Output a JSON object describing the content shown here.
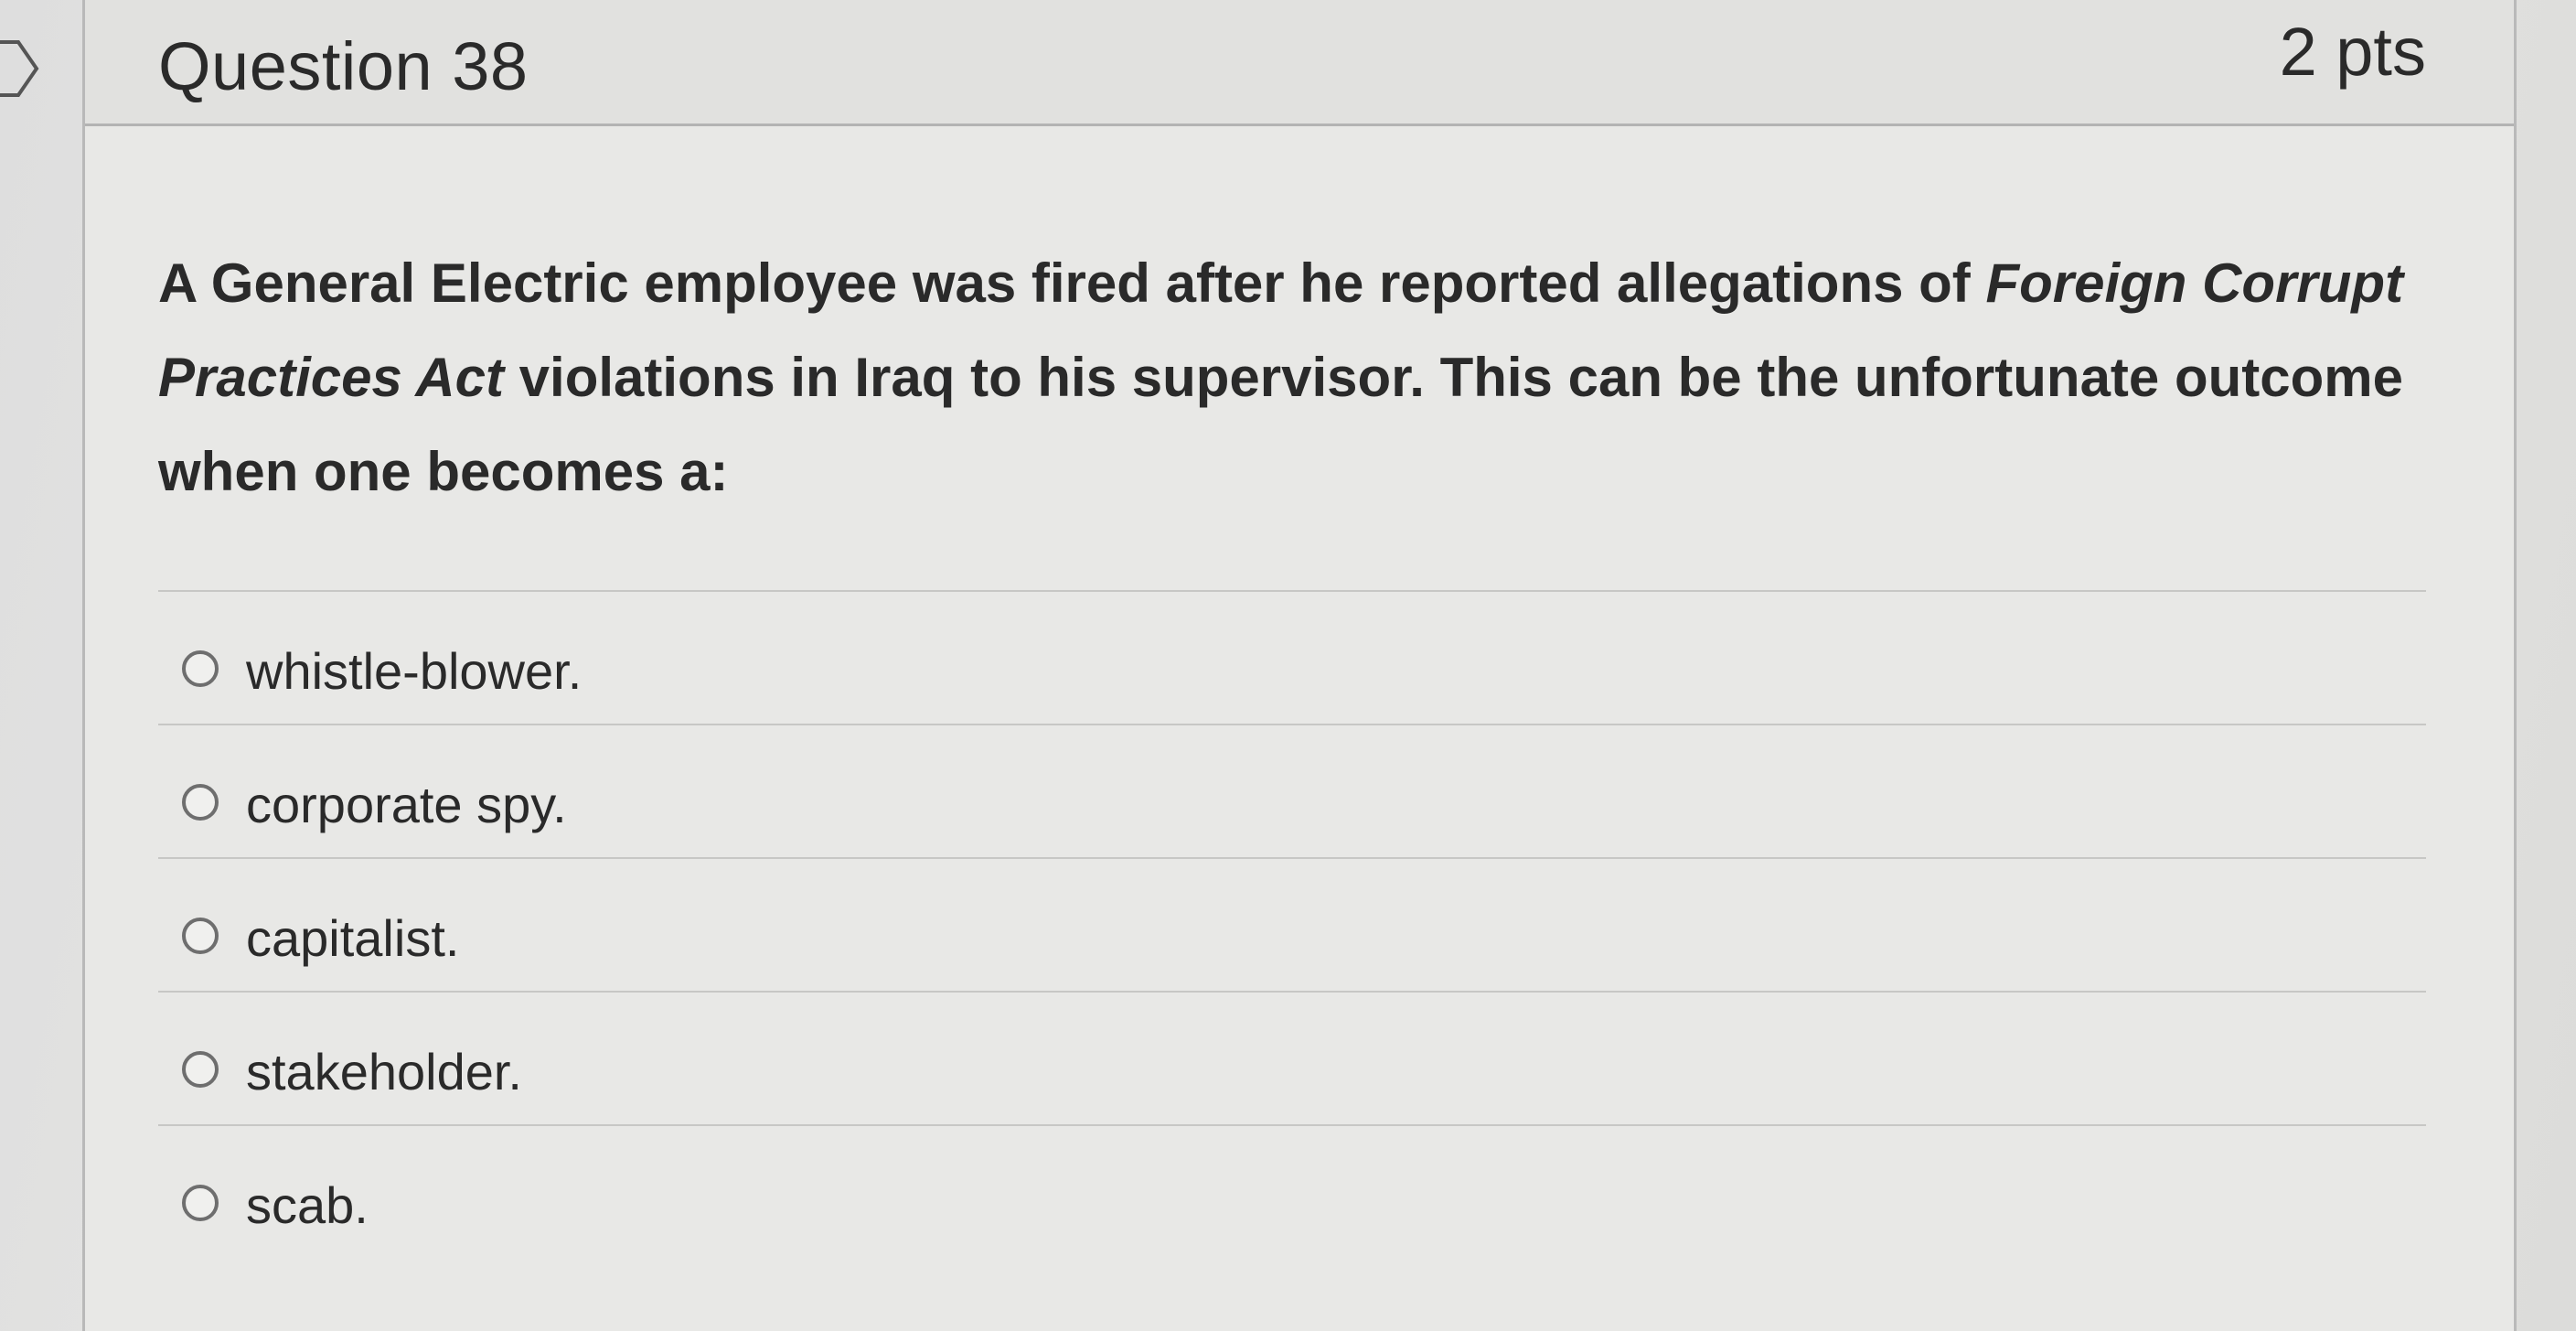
{
  "question": {
    "title": "Question 38",
    "points": "2 pts",
    "text_part1": "A General Electric employee was fired after he reported allegations of ",
    "text_italic": "Foreign Corrupt Practices Act",
    "text_part2": " violations in Iraq to his supervisor. This can be the unfortunate outcome when one becomes a:"
  },
  "answers": [
    {
      "label": "whistle-blower."
    },
    {
      "label": "corporate spy."
    },
    {
      "label": "capitalist."
    },
    {
      "label": "stakeholder."
    },
    {
      "label": "scab."
    }
  ],
  "colors": {
    "text": "#2a2a2a",
    "background": "#e8e8e6",
    "divider": "#c7c7c5"
  }
}
